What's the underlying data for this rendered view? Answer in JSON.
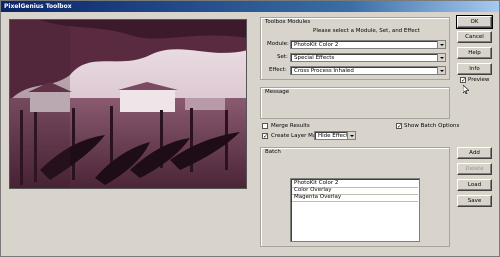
{
  "window": {
    "title": "PixelGenius Toolbox"
  },
  "modules_group": {
    "title": "Toolbox Modules",
    "instruction": "Please select a Module, Set, and Effect",
    "module_label": "Module:",
    "module_value": "PhotoKit Color 2",
    "set_label": "Set:",
    "set_value": "Special Effects",
    "effect_label": "Effect:",
    "effect_value": "Cross Process Inhaled"
  },
  "message_group": {
    "title": "Message"
  },
  "options": {
    "merge_results": "Merge Results",
    "merge_checked": false,
    "show_batch_options": "Show Batch Options",
    "show_batch_checked": true,
    "create_layer_mask": "Create Layer Mask:",
    "create_layer_mask_checked": true,
    "layer_mask_value": "Hide Effect"
  },
  "batch_group": {
    "title": "Batch",
    "items": [
      "PhotoKit Color 2",
      "Color Overlay",
      "Magenta Overlay"
    ]
  },
  "buttons": {
    "ok": "OK",
    "cancel": "Cancel",
    "help": "Help",
    "info": "Info",
    "preview_label": "Preview",
    "preview_checked": true,
    "add": "Add",
    "delete": "Delete",
    "load": "Load",
    "save": "Save"
  }
}
